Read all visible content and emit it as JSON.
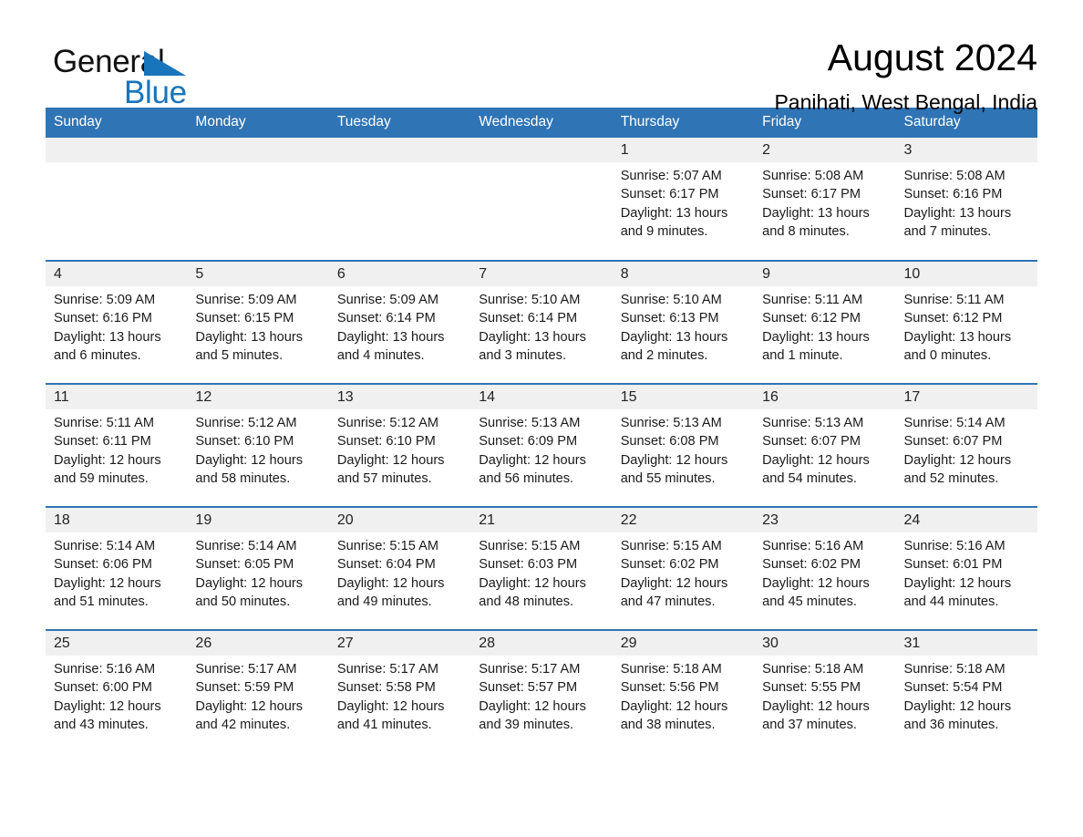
{
  "brand": {
    "name_part1": "General",
    "name_part2": "Blue",
    "triangle_color": "#1874bb"
  },
  "header": {
    "title": "August 2024",
    "subtitle": "Panihati, West Bengal, India"
  },
  "theme": {
    "header_bar_color": "#2f74b5",
    "day_band_color": "#f0f0f0",
    "row_divider_color": "#2f74b5",
    "text_color": "#1a1a1a"
  },
  "labels": {
    "sunrise_prefix": "Sunrise:",
    "sunset_prefix": "Sunset:",
    "daylight_prefix": "Daylight:"
  },
  "weekday_headers": [
    "Sunday",
    "Monday",
    "Tuesday",
    "Wednesday",
    "Thursday",
    "Friday",
    "Saturday"
  ],
  "weeks": [
    [
      {
        "day": "",
        "empty": true
      },
      {
        "day": "",
        "empty": true
      },
      {
        "day": "",
        "empty": true
      },
      {
        "day": "",
        "empty": true
      },
      {
        "day": "1",
        "sunrise": "Sunrise: 5:07 AM",
        "sunset": "Sunset: 6:17 PM",
        "daylight": "Daylight: 13 hours and 9 minutes."
      },
      {
        "day": "2",
        "sunrise": "Sunrise: 5:08 AM",
        "sunset": "Sunset: 6:17 PM",
        "daylight": "Daylight: 13 hours and 8 minutes."
      },
      {
        "day": "3",
        "sunrise": "Sunrise: 5:08 AM",
        "sunset": "Sunset: 6:16 PM",
        "daylight": "Daylight: 13 hours and 7 minutes."
      }
    ],
    [
      {
        "day": "4",
        "sunrise": "Sunrise: 5:09 AM",
        "sunset": "Sunset: 6:16 PM",
        "daylight": "Daylight: 13 hours and 6 minutes."
      },
      {
        "day": "5",
        "sunrise": "Sunrise: 5:09 AM",
        "sunset": "Sunset: 6:15 PM",
        "daylight": "Daylight: 13 hours and 5 minutes."
      },
      {
        "day": "6",
        "sunrise": "Sunrise: 5:09 AM",
        "sunset": "Sunset: 6:14 PM",
        "daylight": "Daylight: 13 hours and 4 minutes."
      },
      {
        "day": "7",
        "sunrise": "Sunrise: 5:10 AM",
        "sunset": "Sunset: 6:14 PM",
        "daylight": "Daylight: 13 hours and 3 minutes."
      },
      {
        "day": "8",
        "sunrise": "Sunrise: 5:10 AM",
        "sunset": "Sunset: 6:13 PM",
        "daylight": "Daylight: 13 hours and 2 minutes."
      },
      {
        "day": "9",
        "sunrise": "Sunrise: 5:11 AM",
        "sunset": "Sunset: 6:12 PM",
        "daylight": "Daylight: 13 hours and 1 minute."
      },
      {
        "day": "10",
        "sunrise": "Sunrise: 5:11 AM",
        "sunset": "Sunset: 6:12 PM",
        "daylight": "Daylight: 13 hours and 0 minutes."
      }
    ],
    [
      {
        "day": "11",
        "sunrise": "Sunrise: 5:11 AM",
        "sunset": "Sunset: 6:11 PM",
        "daylight": "Daylight: 12 hours and 59 minutes."
      },
      {
        "day": "12",
        "sunrise": "Sunrise: 5:12 AM",
        "sunset": "Sunset: 6:10 PM",
        "daylight": "Daylight: 12 hours and 58 minutes."
      },
      {
        "day": "13",
        "sunrise": "Sunrise: 5:12 AM",
        "sunset": "Sunset: 6:10 PM",
        "daylight": "Daylight: 12 hours and 57 minutes."
      },
      {
        "day": "14",
        "sunrise": "Sunrise: 5:13 AM",
        "sunset": "Sunset: 6:09 PM",
        "daylight": "Daylight: 12 hours and 56 minutes."
      },
      {
        "day": "15",
        "sunrise": "Sunrise: 5:13 AM",
        "sunset": "Sunset: 6:08 PM",
        "daylight": "Daylight: 12 hours and 55 minutes."
      },
      {
        "day": "16",
        "sunrise": "Sunrise: 5:13 AM",
        "sunset": "Sunset: 6:07 PM",
        "daylight": "Daylight: 12 hours and 54 minutes."
      },
      {
        "day": "17",
        "sunrise": "Sunrise: 5:14 AM",
        "sunset": "Sunset: 6:07 PM",
        "daylight": "Daylight: 12 hours and 52 minutes."
      }
    ],
    [
      {
        "day": "18",
        "sunrise": "Sunrise: 5:14 AM",
        "sunset": "Sunset: 6:06 PM",
        "daylight": "Daylight: 12 hours and 51 minutes."
      },
      {
        "day": "19",
        "sunrise": "Sunrise: 5:14 AM",
        "sunset": "Sunset: 6:05 PM",
        "daylight": "Daylight: 12 hours and 50 minutes."
      },
      {
        "day": "20",
        "sunrise": "Sunrise: 5:15 AM",
        "sunset": "Sunset: 6:04 PM",
        "daylight": "Daylight: 12 hours and 49 minutes."
      },
      {
        "day": "21",
        "sunrise": "Sunrise: 5:15 AM",
        "sunset": "Sunset: 6:03 PM",
        "daylight": "Daylight: 12 hours and 48 minutes."
      },
      {
        "day": "22",
        "sunrise": "Sunrise: 5:15 AM",
        "sunset": "Sunset: 6:02 PM",
        "daylight": "Daylight: 12 hours and 47 minutes."
      },
      {
        "day": "23",
        "sunrise": "Sunrise: 5:16 AM",
        "sunset": "Sunset: 6:02 PM",
        "daylight": "Daylight: 12 hours and 45 minutes."
      },
      {
        "day": "24",
        "sunrise": "Sunrise: 5:16 AM",
        "sunset": "Sunset: 6:01 PM",
        "daylight": "Daylight: 12 hours and 44 minutes."
      }
    ],
    [
      {
        "day": "25",
        "sunrise": "Sunrise: 5:16 AM",
        "sunset": "Sunset: 6:00 PM",
        "daylight": "Daylight: 12 hours and 43 minutes."
      },
      {
        "day": "26",
        "sunrise": "Sunrise: 5:17 AM",
        "sunset": "Sunset: 5:59 PM",
        "daylight": "Daylight: 12 hours and 42 minutes."
      },
      {
        "day": "27",
        "sunrise": "Sunrise: 5:17 AM",
        "sunset": "Sunset: 5:58 PM",
        "daylight": "Daylight: 12 hours and 41 minutes."
      },
      {
        "day": "28",
        "sunrise": "Sunrise: 5:17 AM",
        "sunset": "Sunset: 5:57 PM",
        "daylight": "Daylight: 12 hours and 39 minutes."
      },
      {
        "day": "29",
        "sunrise": "Sunrise: 5:18 AM",
        "sunset": "Sunset: 5:56 PM",
        "daylight": "Daylight: 12 hours and 38 minutes."
      },
      {
        "day": "30",
        "sunrise": "Sunrise: 5:18 AM",
        "sunset": "Sunset: 5:55 PM",
        "daylight": "Daylight: 12 hours and 37 minutes."
      },
      {
        "day": "31",
        "sunrise": "Sunrise: 5:18 AM",
        "sunset": "Sunset: 5:54 PM",
        "daylight": "Daylight: 12 hours and 36 minutes."
      }
    ]
  ]
}
